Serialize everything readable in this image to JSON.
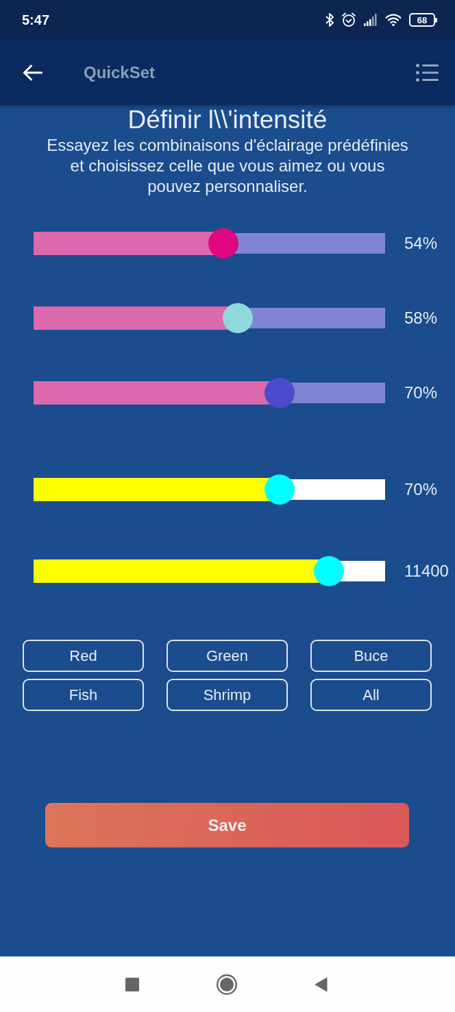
{
  "status_bar": {
    "time": "5:47",
    "battery": "68"
  },
  "app_bar": {
    "title": "QuickSet"
  },
  "header": {
    "title": "Définir l\\\\'intensité",
    "description": "Essayez les combinaisons d'éclairage prédéfinies et choisissez celle que vous aimez ou vous pouvez personnaliser."
  },
  "sliders": [
    {
      "kind": "channel",
      "level": 0.54,
      "color": "#e0067f",
      "reading": "54%"
    },
    {
      "kind": "channel",
      "level": 0.58,
      "color": "#8fd8dc",
      "reading": "58%"
    },
    {
      "kind": "channel",
      "level": 0.7,
      "color": "#4a4ccc",
      "reading": "70%"
    },
    {
      "kind": "master",
      "level": 0.7,
      "color": "#00ffff",
      "reading": "70%"
    },
    {
      "kind": "master",
      "level": 0.84,
      "color": "#00ffff",
      "reading": "11400"
    }
  ],
  "presets": [
    "Red",
    "Green",
    "Buce",
    "Fish",
    "Shrimp",
    "All"
  ],
  "save_button": {
    "label": "Save"
  }
}
